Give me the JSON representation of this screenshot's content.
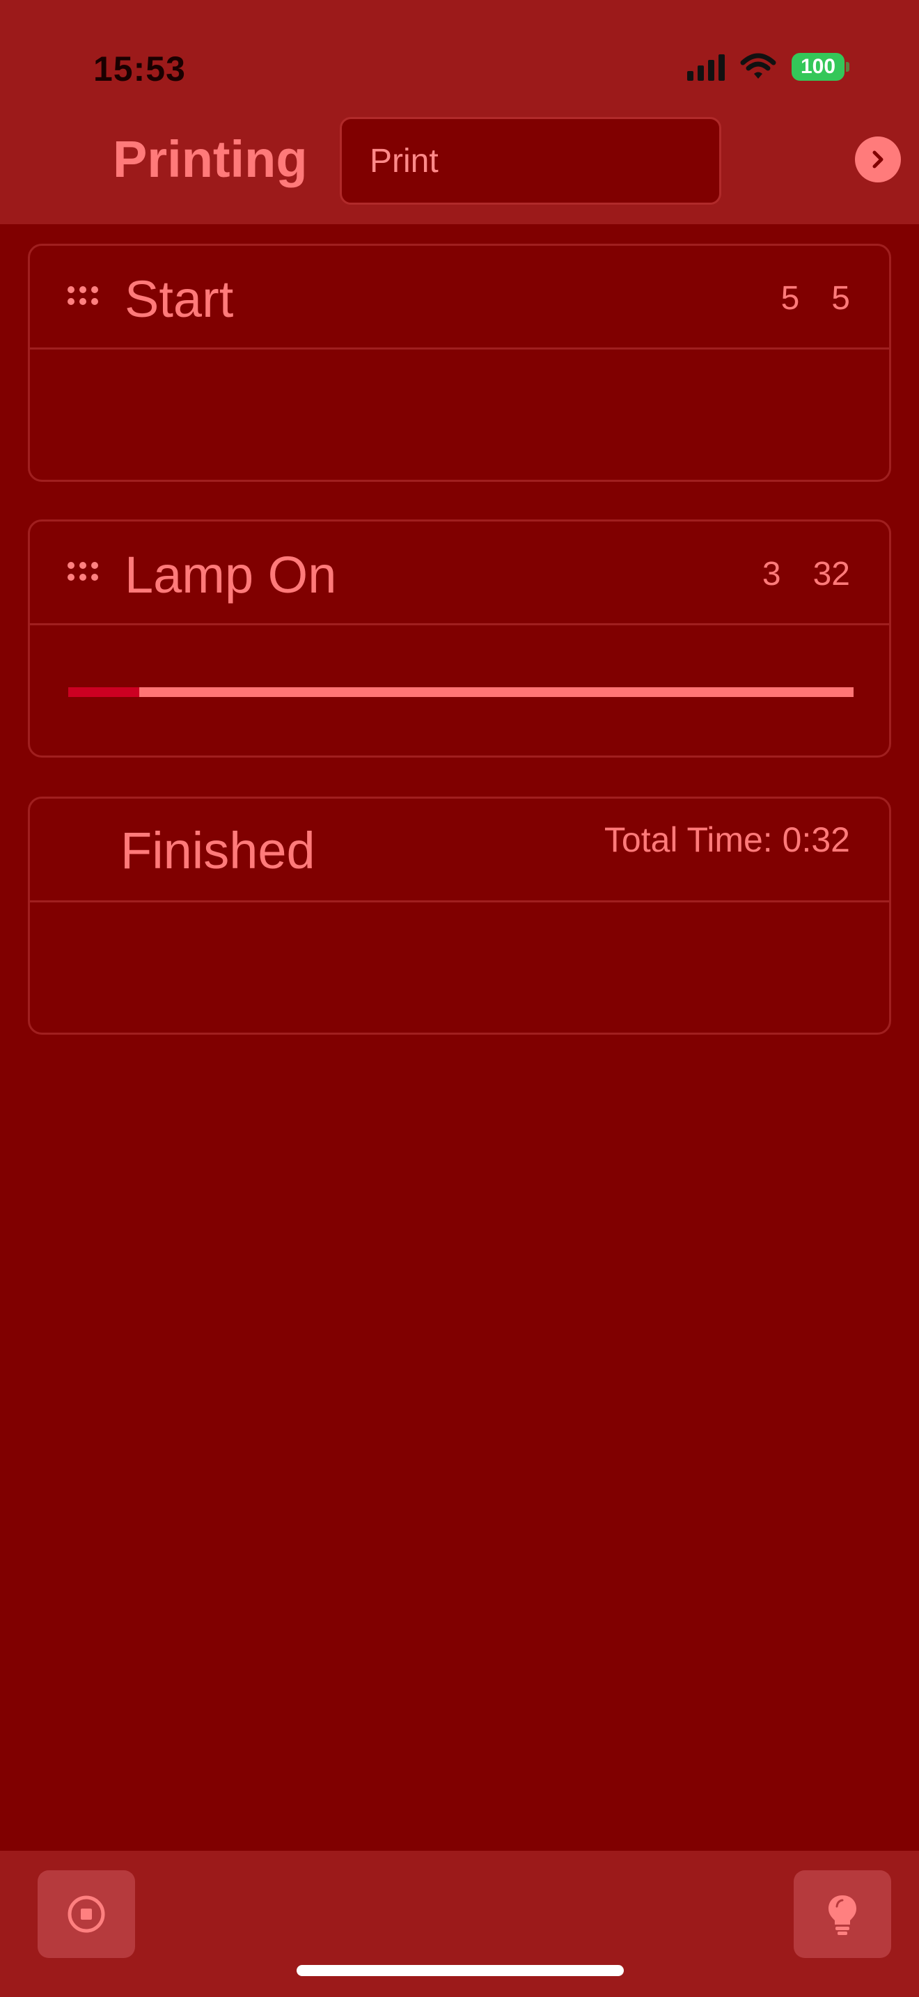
{
  "status_bar": {
    "time": "15:53",
    "battery": "100"
  },
  "header": {
    "title": "Printing",
    "input_value": "Print"
  },
  "steps": [
    {
      "title": "Start",
      "value_a": "5",
      "value_b": "5"
    },
    {
      "title": "Lamp On",
      "value_a": "3",
      "value_b": "32",
      "progress": 0.09
    }
  ],
  "finished": {
    "title": "Finished",
    "total_label": "Total Time:",
    "total_value": "0:32"
  },
  "icons": {
    "next": "chevron-right-icon",
    "stop": "stop-circle-icon",
    "lamp": "lightbulb-icon"
  },
  "colors": {
    "background": "#800000",
    "bar": "#9c1a1a",
    "accent": "#ff7a7a",
    "progress_fill": "#cc0022",
    "battery": "#34c759"
  }
}
